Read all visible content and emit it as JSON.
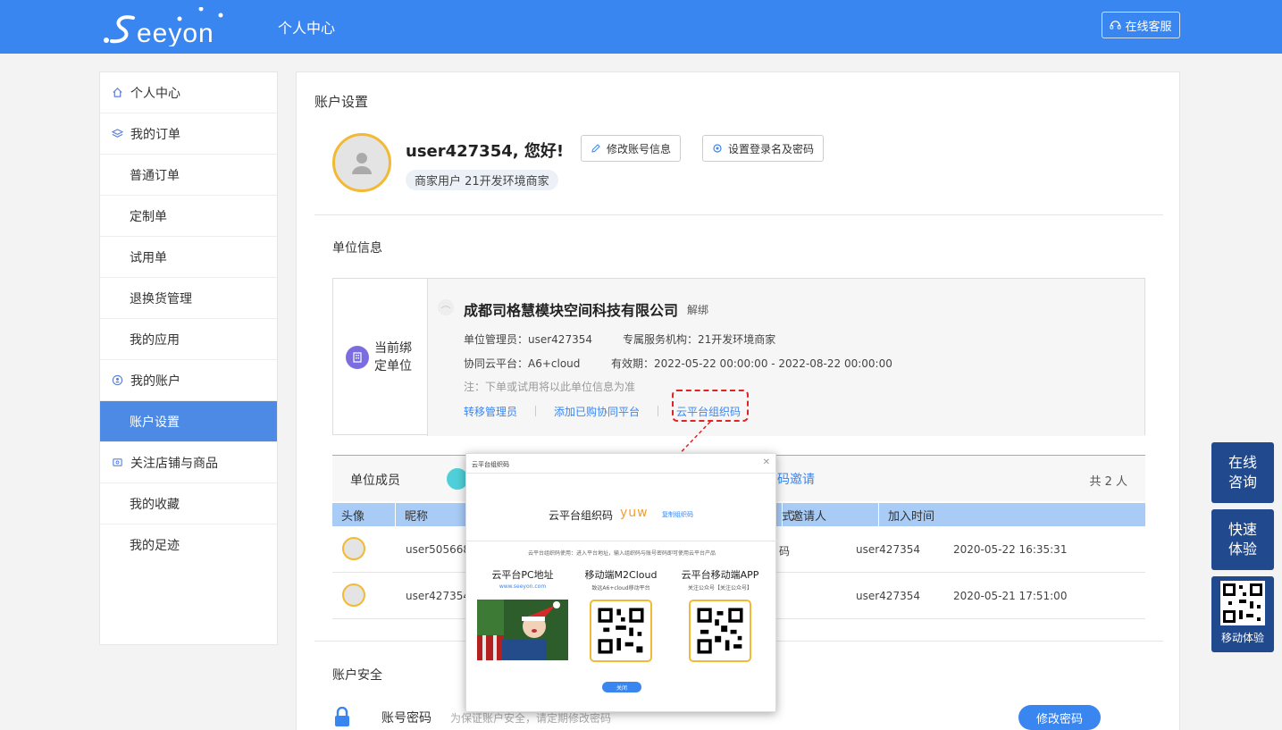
{
  "header": {
    "logo_text": "Seeyon",
    "title": "个人中心",
    "service_label": "在线客服"
  },
  "sidebar": {
    "items": [
      {
        "label": "个人中心",
        "icon": "home-icon"
      },
      {
        "label": "我的订单",
        "icon": "layers-icon"
      },
      {
        "label": "普通订单"
      },
      {
        "label": "定制单"
      },
      {
        "label": "试用单"
      },
      {
        "label": "退换货管理"
      },
      {
        "label": "我的应用"
      },
      {
        "label": "我的账户",
        "icon": "user-circle-icon"
      },
      {
        "label": "账户设置",
        "active": true
      },
      {
        "label": "关注店铺与商品",
        "icon": "store-icon"
      },
      {
        "label": "我的收藏"
      },
      {
        "label": "我的足迹"
      }
    ]
  },
  "account": {
    "section_title": "账户设置",
    "greeting": "user427354, 您好!",
    "edit_btn": "修改账号信息",
    "login_btn": "设置登录名及密码",
    "user_tag": "商家用户 21开发环境商家"
  },
  "org": {
    "section_title": "单位信息",
    "left_label": "当前绑定单位",
    "company": "成都司格慧模块空间科技有限公司",
    "unbind": "解绑",
    "admin": "单位管理员：user427354",
    "agency": "专属服务机构：21开发环境商家",
    "platform": "协同云平台：A6+cloud",
    "validity": "有效期：2022-05-22 00:00:00 - 2022-08-22 00:00:00",
    "note": "注：下单或试用将以此单位信息为准",
    "link_transfer": "转移管理员",
    "link_add": "添加已购协同平台",
    "link_code": "云平台组织码"
  },
  "members": {
    "title": "单位成员",
    "invite_partial": "码邀请",
    "count": "共 2 人",
    "columns": [
      "头像",
      "昵称",
      "式",
      "邀请人",
      "加入时间"
    ],
    "rows": [
      {
        "nick": "user505668",
        "method": "码",
        "inviter": "user427354",
        "time": "2020-05-22 16:35:31"
      },
      {
        "nick": "user427354",
        "method": "",
        "inviter": "user427354",
        "time": "2020-05-21 17:51:00"
      }
    ]
  },
  "security": {
    "title": "账户安全",
    "pwd_label": "账号密码",
    "pwd_hint": "为保证账户安全，请定期修改密码",
    "pwd_btn": "修改密码"
  },
  "widgets": {
    "consult": "在线咨询",
    "trial": "快速体验",
    "mobile": "移动体验"
  },
  "modal": {
    "title": "云平台组织码",
    "code_label": "云平台组织码",
    "code": "yuw",
    "copy": "复制组织码",
    "desc": "云平台组织码使用：进入平台地址，输入组织码与账号密码即可使用云平台产品",
    "pc_title": "云平台PC地址",
    "pc_url": "www.seeyon.com",
    "m2_title": "移动端M2Cloud",
    "m2_sub": "致远A6+cloud移动平台",
    "app_title": "云平台移动端APP",
    "app_sub": "关注公众号【关注公众号】",
    "close_btn": "关闭"
  },
  "colors": {
    "primary": "#3a86f0",
    "sidebar_active": "#4c8ae6",
    "widget_bg": "#214a8e",
    "avatar_ring": "#f2b935",
    "highlight": "#e02424"
  }
}
